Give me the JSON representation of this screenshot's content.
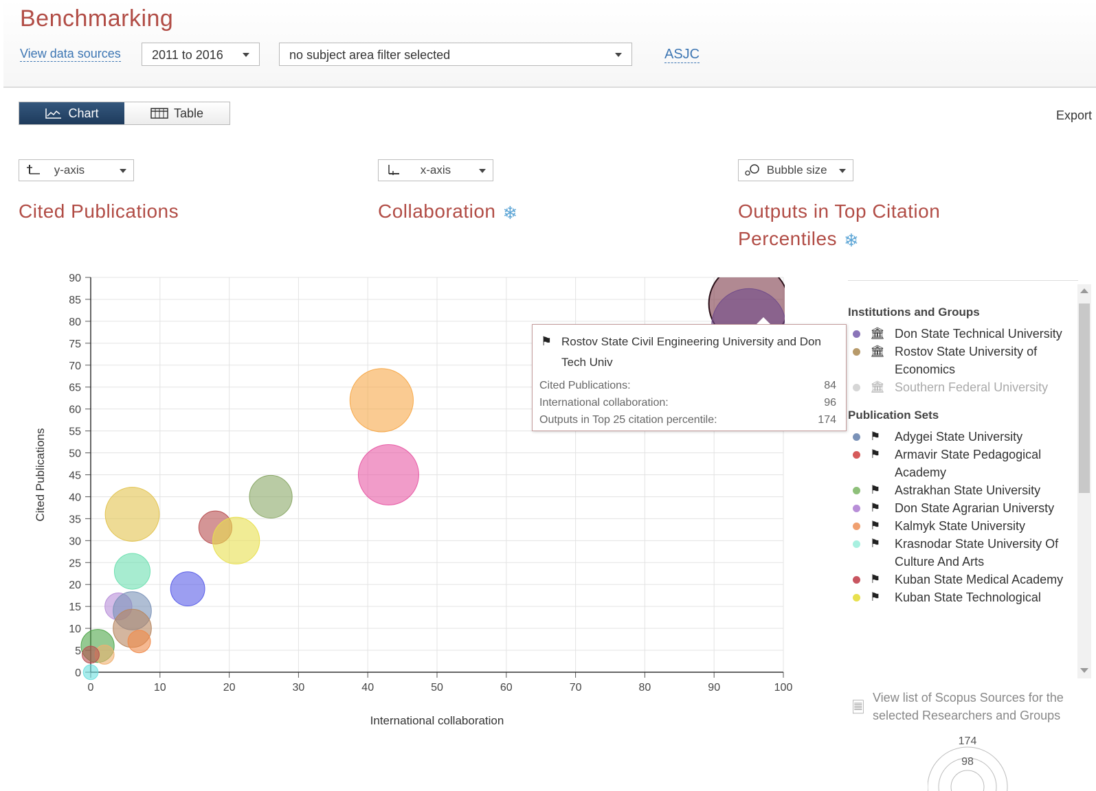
{
  "header": {
    "title": "Benchmarking",
    "view_sources": "View data sources",
    "year_range": "2011 to 2016",
    "subject_filter": "no subject area filter selected",
    "asjc": "ASJC"
  },
  "toolbar": {
    "chart_label": "Chart",
    "table_label": "Table",
    "export_label": "Export",
    "chart_icon": "line-chart-icon",
    "table_icon": "table-grid-icon"
  },
  "axes": {
    "y_select": "y-axis",
    "x_select": "x-axis",
    "bubble_select": "Bubble size",
    "y_metric": "Cited Publications",
    "x_metric": "Collaboration",
    "bubble_metric_line1": "Outputs in Top Citation",
    "bubble_metric_line2": "Percentiles",
    "settings_icon": "gear-icon"
  },
  "chart_data": {
    "type": "scatter",
    "xlabel": "International collaboration",
    "ylabel": "Cited Publications",
    "xlim": [
      0,
      100
    ],
    "ylim": [
      0,
      90
    ],
    "x_ticks": [
      "0",
      "10",
      "20",
      "30",
      "40",
      "50",
      "60",
      "70",
      "80",
      "90",
      "100"
    ],
    "y_ticks": [
      "0",
      "5",
      "10",
      "15",
      "20",
      "25",
      "30",
      "35",
      "40",
      "45",
      "50",
      "55",
      "60",
      "65",
      "70",
      "75",
      "80",
      "85",
      "90"
    ],
    "grid": true,
    "points": [
      {
        "x": 95,
        "y": 84,
        "size": 174,
        "color": "#7d3a4a",
        "outline": true
      },
      {
        "x": 95,
        "y": 79,
        "size": 150,
        "color": "#6f4a8a"
      },
      {
        "x": 42,
        "y": 62,
        "size": 110,
        "color": "#f7a94a"
      },
      {
        "x": 43,
        "y": 45,
        "size": 100,
        "color": "#e75aa5"
      },
      {
        "x": 26,
        "y": 40,
        "size": 50,
        "color": "#8aa867"
      },
      {
        "x": 6,
        "y": 36,
        "size": 80,
        "color": "#e2c34e"
      },
      {
        "x": 18,
        "y": 33,
        "size": 30,
        "color": "#b84e50"
      },
      {
        "x": 21,
        "y": 30,
        "size": 60,
        "color": "#e8e04e"
      },
      {
        "x": 6,
        "y": 23,
        "size": 35,
        "color": "#6de0b0"
      },
      {
        "x": 14,
        "y": 19,
        "size": 32,
        "color": "#5a5ee8"
      },
      {
        "x": 4,
        "y": 15,
        "size": 20,
        "color": "#b88ed8"
      },
      {
        "x": 6,
        "y": 14,
        "size": 40,
        "color": "#7a92b8"
      },
      {
        "x": 6,
        "y": 10,
        "size": 40,
        "color": "#b7865f"
      },
      {
        "x": 7,
        "y": 7,
        "size": 14,
        "color": "#f08a4a"
      },
      {
        "x": 1,
        "y": 6,
        "size": 30,
        "color": "#4fa64a"
      },
      {
        "x": 2,
        "y": 4,
        "size": 10,
        "color": "#f0b070"
      },
      {
        "x": 0,
        "y": 4,
        "size": 8,
        "color": "#b84e50"
      },
      {
        "x": 0,
        "y": 0,
        "size": 6,
        "color": "#6de0e0"
      }
    ]
  },
  "tooltip": {
    "title": "Rostov State Civil Engineering University and Don Tech Univ",
    "icon": "publication-set-icon",
    "rows": [
      {
        "label": "Cited Publications:",
        "value": "84"
      },
      {
        "label": "International collaboration:",
        "value": "96"
      },
      {
        "label": "Outputs in Top 25 citation percentile:",
        "value": "174"
      }
    ]
  },
  "legend": {
    "institutions_heading": "Institutions and Groups",
    "institutions": [
      {
        "label": "Don State Technical University",
        "color": "#8a74b8",
        "icon": "institution-icon",
        "muted": false
      },
      {
        "label": "Rostov State University of Economics",
        "color": "#b79a6a",
        "icon": "institution-icon",
        "muted": false
      },
      {
        "label": "Southern Federal University",
        "color": "#d6d6d6",
        "icon": "institution-icon",
        "muted": true
      }
    ],
    "sets_heading": "Publication Sets",
    "sets": [
      {
        "label": "Adygei State University",
        "color": "#7a92b8",
        "icon": "publication-set-icon"
      },
      {
        "label": "Armavir State Pedagogical Academy",
        "color": "#d65a5a",
        "icon": "publication-set-icon"
      },
      {
        "label": "Astrakhan State University",
        "color": "#8ec07a",
        "icon": "publication-set-icon"
      },
      {
        "label": "Don State Agrarian Universty",
        "color": "#b88ed8",
        "icon": "publication-set-icon"
      },
      {
        "label": "Kalmyk State University",
        "color": "#f0a070",
        "icon": "publication-set-icon"
      },
      {
        "label": "Krasnodar State University Of Culture And Arts",
        "color": "#a8f0e0",
        "icon": "publication-set-icon"
      },
      {
        "label": "Kuban State Medical Academy",
        "color": "#c85560",
        "icon": "publication-set-icon"
      },
      {
        "label": "Kuban State Technological",
        "color": "#e8e04e",
        "icon": "publication-set-icon"
      }
    ]
  },
  "sources": {
    "link": "View list of Scopus Sources for the selected Researchers and Groups",
    "icon": "document-stack-icon"
  },
  "bubble_key": {
    "max": "174",
    "mid": "98"
  }
}
